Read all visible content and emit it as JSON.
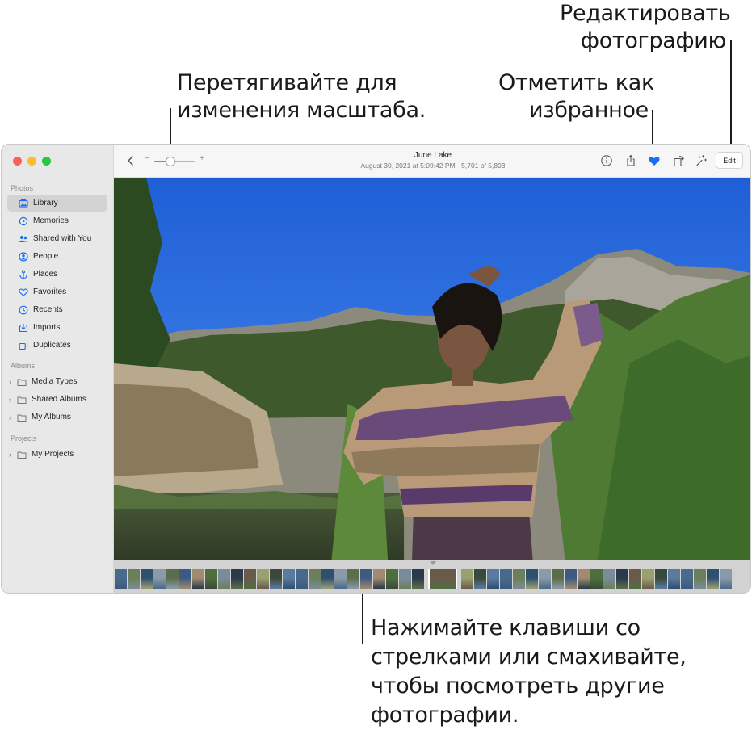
{
  "callouts": {
    "zoom": [
      "Перетягивайте для",
      "изменения масштаба."
    ],
    "favorite": [
      "Отметить как",
      "избранное"
    ],
    "edit": [
      "Редактировать",
      "фотографию"
    ],
    "navigate": [
      "Нажимайте клавиши со",
      "стрелками или смахивайте,",
      "чтобы посмотреть другие",
      "фотографии."
    ]
  },
  "sidebar": {
    "sections": {
      "photos": "Photos",
      "albums": "Albums",
      "projects": "Projects"
    },
    "photo_items": [
      {
        "label": "Library",
        "icon": "library-icon",
        "selected": true
      },
      {
        "label": "Memories",
        "icon": "memories-icon"
      },
      {
        "label": "Shared with You",
        "icon": "shared-with-you-icon"
      },
      {
        "label": "People",
        "icon": "people-icon"
      },
      {
        "label": "Places",
        "icon": "places-icon"
      },
      {
        "label": "Favorites",
        "icon": "heart-icon"
      },
      {
        "label": "Recents",
        "icon": "clock-icon"
      },
      {
        "label": "Imports",
        "icon": "import-icon"
      },
      {
        "label": "Duplicates",
        "icon": "duplicates-icon"
      }
    ],
    "album_items": [
      {
        "label": "Media Types",
        "icon": "folder-icon"
      },
      {
        "label": "Shared Albums",
        "icon": "folder-icon"
      },
      {
        "label": "My Albums",
        "icon": "folder-icon"
      }
    ],
    "project_items": [
      {
        "label": "My Projects",
        "icon": "folder-icon"
      }
    ]
  },
  "toolbar": {
    "zoom_minus": "−",
    "zoom_plus": "+",
    "zoom_level": 0.4,
    "title": "June Lake",
    "subtitle": "August 30, 2021 at 5:09:42 PM  ·  5,701 of 5,893",
    "edit_label": "Edit",
    "favorite_color": "#1a6ef5"
  },
  "colors": {
    "sidebar_bg": "#e8e8e8",
    "accent": "#1a6ef5"
  }
}
